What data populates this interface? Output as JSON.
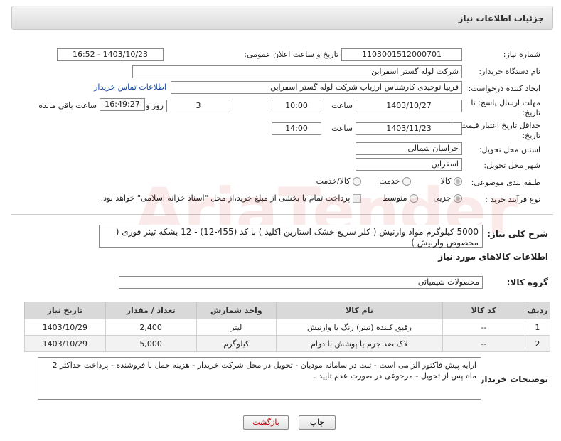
{
  "header": {
    "title": "جزئیات اطلاعات نیاز"
  },
  "form": {
    "need_number_label": "شماره نیاز:",
    "need_number": "1103001512000701",
    "announce_label": "تاریخ و ساعت اعلان عمومی:",
    "announce_value": "1403/10/23 - 16:52",
    "buyer_org_label": "نام دستگاه خریدار:",
    "buyer_org": "شرکت لوله گستر اسفراین",
    "requester_label": "ایجاد کننده درخواست:",
    "requester": "قربیا توحیدی کارشناس ارزیاب شرکت لوله گستر اسفراین",
    "contact_link": "اطلاعات تماس خریدار",
    "deadline_label_1": "مهلت ارسال پاسخ: تا",
    "deadline_label_2": "تاریخ:",
    "deadline_date": "1403/10/27",
    "time_label": "ساعت",
    "deadline_time": "10:00",
    "days": "3",
    "days_label": "روز و",
    "remaining_time": "16:49:27",
    "remaining_label": "ساعت باقی مانده",
    "validity_label_1": "حداقل تاریخ اعتبار قیمت: تا",
    "validity_label_2": "تاریخ:",
    "validity_date": "1403/11/23",
    "validity_time_label": "ساعت",
    "validity_time": "14:00",
    "province_label": "استان محل تحویل:",
    "province": "خراسان شمالی",
    "city_label": "شهر محل تحویل:",
    "city": "اسفراین",
    "category_label": "طبقه بندی موضوعی:",
    "category_options": [
      "کالا",
      "خدمت",
      "کالا/خدمت"
    ],
    "process_label": "نوع فرآیند خرید :",
    "process_options": [
      "جزیی",
      "متوسط"
    ],
    "payment_note": "پرداخت تمام یا بخشی از مبلغ خرید،از محل \"اسناد خزانه اسلامی\" خواهد بود."
  },
  "description": {
    "label": "شرح کلی نیاز:",
    "text": "5000 کیلوگرم مواد وارنیش ( کلر سریع خشک استارین اکلید ) با کد (455-12)  - 12 بشکه تینر فوری ( مخصوص وارنیش )"
  },
  "goods": {
    "section_title": "اطلاعات کالاهای مورد نیاز",
    "group_label": "گروه کالا:",
    "group_value": "محصولات شیمیائی",
    "columns": [
      "ردیف",
      "کد کالا",
      "نام کالا",
      "واحد شمارش",
      "تعداد / مقدار",
      "تاریخ نیاز"
    ],
    "rows": [
      {
        "index": "1",
        "code": "--",
        "name": "رقیق کننده (تینر) رنگ یا وارنیش",
        "unit": "لیتر",
        "qty": "2,400",
        "date": "1403/10/29"
      },
      {
        "index": "2",
        "code": "--",
        "name": "لاک ضد جرم یا پوشش با دوام",
        "unit": "کیلوگرم",
        "qty": "5,000",
        "date": "1403/10/29"
      }
    ]
  },
  "notes": {
    "label": "توضیحات خریدار:",
    "text": "ارایه پیش فاکتور الزامی است - ثبت در سامانه مودیان - تحویل در محل شرکت خریدار - هزینه حمل با فروشنده - پرداخت حداکثر 2 ماه پس از تحویل - مرجوعی در صورت عدم تایید ."
  },
  "buttons": {
    "print": "چاپ",
    "back": "بازگشت"
  },
  "colors": {
    "link": "#1a4aa6",
    "back_text": "#c00000",
    "header_bg": "#dcdcdc"
  }
}
